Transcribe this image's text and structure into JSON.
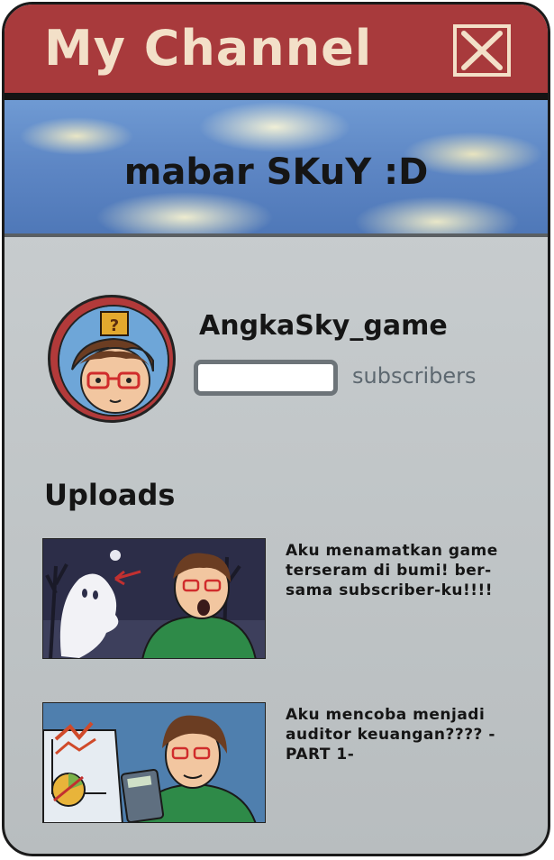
{
  "window": {
    "title": "My Channel",
    "close_icon": "close-x-icon"
  },
  "banner": {
    "text": "mabar SKuY :D"
  },
  "profile": {
    "avatar_icon": "avatar-character-icon",
    "channel_name": "AngkaSky_game",
    "subscriber_count": "",
    "subscribers_label": "subscribers"
  },
  "uploads": {
    "heading": "Uploads",
    "videos": [
      {
        "title": "Aku menamatkan game terseram di bumi! ber-sama subscriber-ku!!!!",
        "thumbnail_icon": "ghost-scared-thumbnail"
      },
      {
        "title": "Aku mencoba menjadi auditor keuangan???? -PART 1-",
        "thumbnail_icon": "calculator-chart-thumbnail"
      }
    ]
  },
  "colors": {
    "titlebar": "#a83a3c",
    "title_text": "#f3e0c8",
    "banner_sky": "#5d86c4",
    "body_bg": "#c3c8ca",
    "subscribers_text": "#5d6870"
  }
}
